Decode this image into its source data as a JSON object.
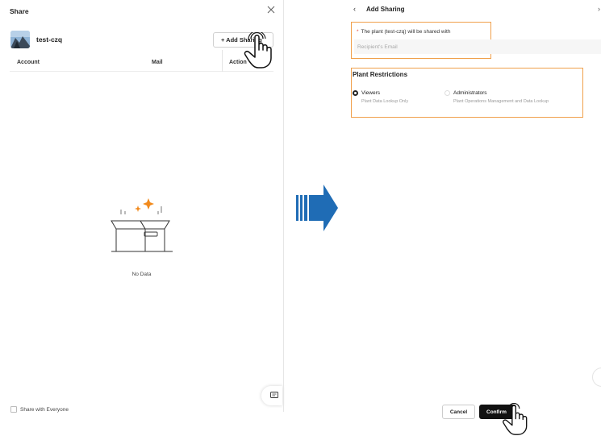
{
  "share_panel": {
    "title": "Share",
    "plant_name": "test-czq",
    "add_button_label": "+ Add Sharing",
    "columns": [
      "Account",
      "Mail",
      "Action"
    ],
    "empty_text": "No Data",
    "share_everyone_label": "Share with Everyone"
  },
  "add_sharing": {
    "back_icon": "chevron-left-icon",
    "title": "Add Sharing",
    "shared_with_label": "The plant (test-czq) will be shared with",
    "email_placeholder": "Recipient's Email",
    "restrictions_title": "Plant Restrictions",
    "options": [
      {
        "label": "Viewers",
        "description": "Plant Data Lookup Only",
        "selected": true
      },
      {
        "label": "Administrators",
        "description": "Plant Operations Management and Data Lookup",
        "selected": false
      }
    ],
    "cancel_label": "Cancel",
    "confirm_label": "Confirm"
  },
  "colors": {
    "highlight": "#f0a04b",
    "arrow": "#1f6cb5",
    "empty_sparkle": "#f28a1c",
    "confirm_bg": "#111111"
  }
}
